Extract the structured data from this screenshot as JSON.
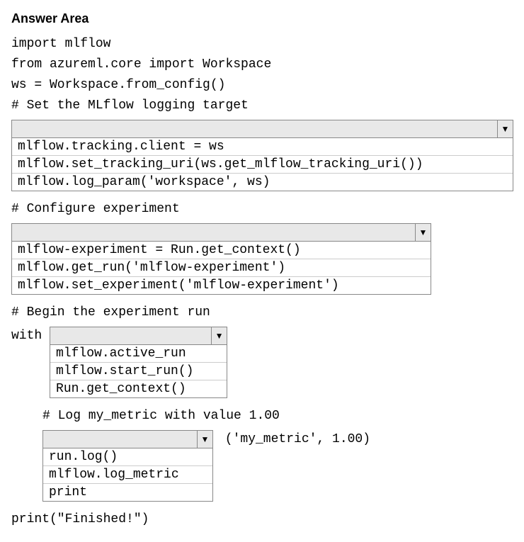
{
  "title": "Answer Area",
  "code": {
    "line1": "import mlflow",
    "line2": "from azureml.core import Workspace",
    "line3": "ws = Workspace.from_config()",
    "comment1": "# Set the MLflow logging target",
    "comment2": "# Configure experiment",
    "comment3": "# Begin the experiment run",
    "with_kw": "with ",
    "comment4": "# Log my_metric with value 1.00",
    "suffix4": " ('my_metric', 1.00)",
    "line_final": "print(\"Finished!\")"
  },
  "dropdown1": {
    "options": [
      "mlflow.tracking.client = ws",
      "mlflow.set_tracking_uri(ws.get_mlflow_tracking_uri())",
      "mlflow.log_param('workspace', ws)"
    ]
  },
  "dropdown2": {
    "options": [
      "mlflow-experiment = Run.get_context()",
      "mlflow.get_run('mlflow-experiment')",
      "mlflow.set_experiment('mlflow-experiment')"
    ]
  },
  "dropdown3": {
    "options": [
      "mlflow.active_run",
      "mlflow.start_run()",
      "Run.get_context()"
    ]
  },
  "dropdown4": {
    "options": [
      "run.log()",
      "mlflow.log_metric",
      "print"
    ]
  }
}
